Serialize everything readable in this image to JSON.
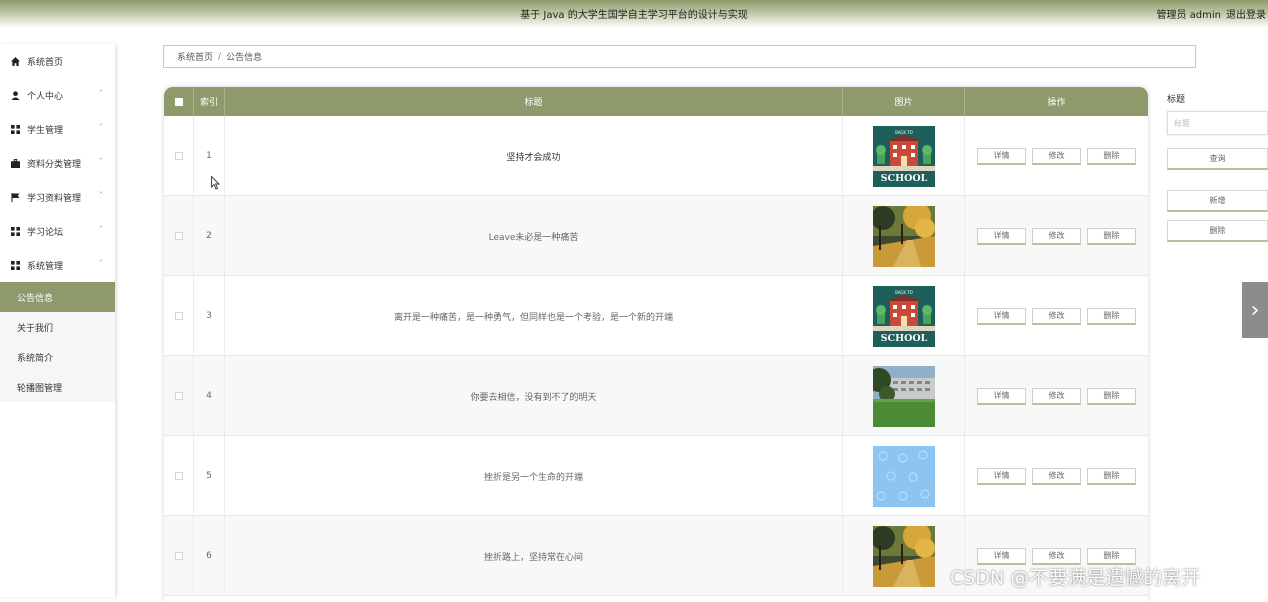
{
  "header": {
    "title": "基于 Java 的大学生国学自主学习平台的设计与实现",
    "user_label": "管理员 admin",
    "logout": "退出登录"
  },
  "sidebar": {
    "items": [
      {
        "label": "系统首页",
        "icon": "home-icon"
      },
      {
        "label": "个人中心",
        "icon": "user-icon",
        "arrow": "˅"
      },
      {
        "label": "学生管理",
        "icon": "grid-icon",
        "arrow": "˅"
      },
      {
        "label": "资料分类管理",
        "icon": "briefcase-icon",
        "arrow": "˅"
      },
      {
        "label": "学习资料管理",
        "icon": "flag-icon",
        "arrow": "˅"
      },
      {
        "label": "学习论坛",
        "icon": "grid-icon",
        "arrow": "˅"
      },
      {
        "label": "系统管理",
        "icon": "grid-icon",
        "arrow": "˄"
      }
    ],
    "subitems": [
      {
        "label": "公告信息",
        "active": true
      },
      {
        "label": "关于我们",
        "active": false
      },
      {
        "label": "系统简介",
        "active": false
      },
      {
        "label": "轮播图管理",
        "active": false
      }
    ]
  },
  "breadcrumb": {
    "home": "系统首页",
    "separator": "/",
    "current": "公告信息"
  },
  "table": {
    "headers": {
      "index": "索引",
      "title": "标题",
      "image": "图片",
      "actions": "操作"
    },
    "action_labels": {
      "detail": "详情",
      "edit": "修改",
      "delete": "删除"
    },
    "rows": [
      {
        "index": "1",
        "title": "坚持才会成功",
        "image": "school"
      },
      {
        "index": "2",
        "title": "Leave未必是一种痛苦",
        "image": "autumn"
      },
      {
        "index": "3",
        "title": "离开是一种痛苦，是一种勇气，但同样也是一个考验，是一个新的开端",
        "image": "school"
      },
      {
        "index": "4",
        "title": "你要去相信，没有到不了的明天",
        "image": "campus"
      },
      {
        "index": "5",
        "title": "挫折是另一个生命的开端",
        "image": "pattern"
      },
      {
        "index": "6",
        "title": "挫折路上，坚持常在心间",
        "image": "autumn"
      }
    ]
  },
  "search_panel": {
    "label": "标题",
    "placeholder": "标题",
    "search_button": "查询",
    "add_button": "新增",
    "delete_button": "删除"
  },
  "thumb_school_text": {
    "top": "BACK TO",
    "bottom": "SCHOOL"
  },
  "pager_next": "›",
  "watermark": "CSDN @不要满是遗憾的离开",
  "colors": {
    "theme": "#8e9a6c",
    "header_gradient_top": "#8e9a6c"
  }
}
